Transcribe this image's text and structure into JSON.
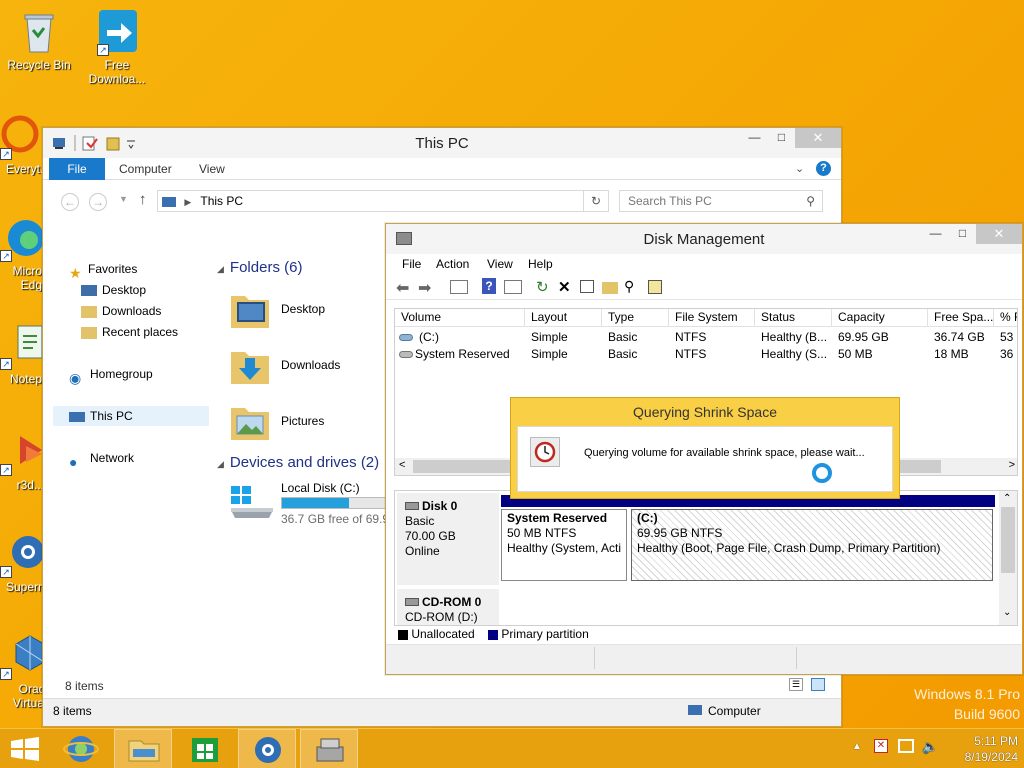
{
  "desktop": {
    "icons": [
      {
        "label": "Recycle Bin"
      },
      {
        "label": "Free Downloa..."
      },
      {
        "label": "Everyt..."
      },
      {
        "label": "Micro... Edg..."
      },
      {
        "label": "Notep..."
      },
      {
        "label": "r3d..."
      },
      {
        "label": "Superm..."
      },
      {
        "label": "Oracle Virtua..."
      }
    ],
    "watermark_line1": "Windows 8.1 Pro",
    "watermark_line2": "Build 9600"
  },
  "explorer": {
    "title": "This PC",
    "tabs": [
      "File",
      "Computer",
      "View"
    ],
    "address": "This PC",
    "search_placeholder": "Search This PC",
    "nav": {
      "favorites": "Favorites",
      "desktop": "Desktop",
      "downloads": "Downloads",
      "recent": "Recent places",
      "homegroup": "Homegroup",
      "thispc": "This PC",
      "network": "Network"
    },
    "folders_header": "Folders (6)",
    "folders": [
      "Desktop",
      "Downloads",
      "Pictures"
    ],
    "devices_header": "Devices and drives (2)",
    "drive": {
      "name": "Local Disk (C:)",
      "free": "36.7 GB free of 69.9",
      "used_fraction": 0.47
    },
    "status_items": "8 items",
    "bottom_status_items": "8 items",
    "bottom_status_computer": "Computer"
  },
  "diskmgmt": {
    "title": "Disk Management",
    "menu": [
      "File",
      "Action",
      "View",
      "Help"
    ],
    "columns": [
      "Volume",
      "Layout",
      "Type",
      "File System",
      "Status",
      "Capacity",
      "Free Spa...",
      "% F"
    ],
    "rows": [
      {
        "volume": "(C:)",
        "layout": "Simple",
        "type": "Basic",
        "fs": "NTFS",
        "status": "Healthy (B...",
        "capacity": "69.95 GB",
        "free": "36.74 GB",
        "pct": "53"
      },
      {
        "volume": "System Reserved",
        "layout": "Simple",
        "type": "Basic",
        "fs": "NTFS",
        "status": "Healthy (S...",
        "capacity": "50 MB",
        "free": "18 MB",
        "pct": "36"
      }
    ],
    "disk0": {
      "name": "Disk 0",
      "type": "Basic",
      "size": "70.00 GB",
      "state": "Online"
    },
    "part_sys": {
      "name": "System Reserved",
      "size": "50 MB NTFS",
      "status": "Healthy (System, Acti"
    },
    "part_c": {
      "name": "(C:)",
      "size": "69.95 GB NTFS",
      "status": "Healthy (Boot, Page File, Crash Dump, Primary Partition)"
    },
    "cdrom": {
      "name": "CD-ROM 0",
      "label": "CD-ROM (D:)"
    },
    "legend": {
      "unallocated": "Unallocated",
      "primary": "Primary partition"
    }
  },
  "dialog": {
    "title": "Querying Shrink Space",
    "message": "Querying volume for available shrink space, please wait..."
  },
  "tray": {
    "time": "5:11 PM",
    "date": "8/19/2024"
  },
  "colors": {
    "accent": "#1979ca",
    "primary_partition": "#000080",
    "dialog": "#f9cf45"
  }
}
